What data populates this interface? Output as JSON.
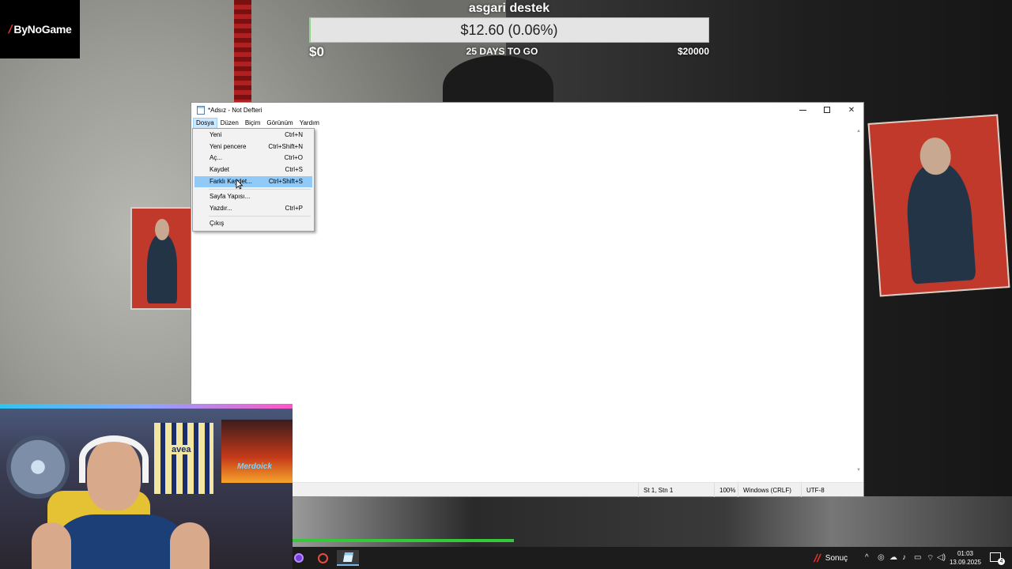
{
  "overlay": {
    "logo_text": "ByNoGame",
    "goal": {
      "title": "asgari destek",
      "amount": "$12.60 (0.06%)",
      "progress_percent": 0.06,
      "min_label": "$0",
      "days_left": "25 DAYS TO GO",
      "max_label": "$20000"
    }
  },
  "notepad": {
    "title": "*Adsız - Not Defteri",
    "menu": [
      "Dosya",
      "Düzen",
      "Biçim",
      "Görünüm",
      "Yardım"
    ],
    "file_menu": [
      {
        "label": "Yeni",
        "shortcut": "Ctrl+N"
      },
      {
        "label": "Yeni pencere",
        "shortcut": "Ctrl+Shift+N"
      },
      {
        "label": "Aç...",
        "shortcut": "Ctrl+O"
      },
      {
        "label": "Kaydet",
        "shortcut": "Ctrl+S"
      },
      {
        "label": "Farklı Kaydet...",
        "shortcut": "Ctrl+Shift+S"
      },
      {
        "label": "Sayfa Yapısı...",
        "shortcut": ""
      },
      {
        "label": "Yazdır...",
        "shortcut": "Ctrl+P"
      },
      {
        "label": "Çıkış",
        "shortcut": ""
      }
    ],
    "status": {
      "position": "St 1, Stn 1",
      "zoom": "100%",
      "line_endings": "Windows (CRLF)",
      "encoding": "UTF-8"
    }
  },
  "webcam": {
    "jersey_text": "avea",
    "poster_text": "Merdoick"
  },
  "taskbar": {
    "weather_label": "Sonuç",
    "time": "01:03",
    "date": "13.09.2025",
    "notification_count": "4"
  }
}
